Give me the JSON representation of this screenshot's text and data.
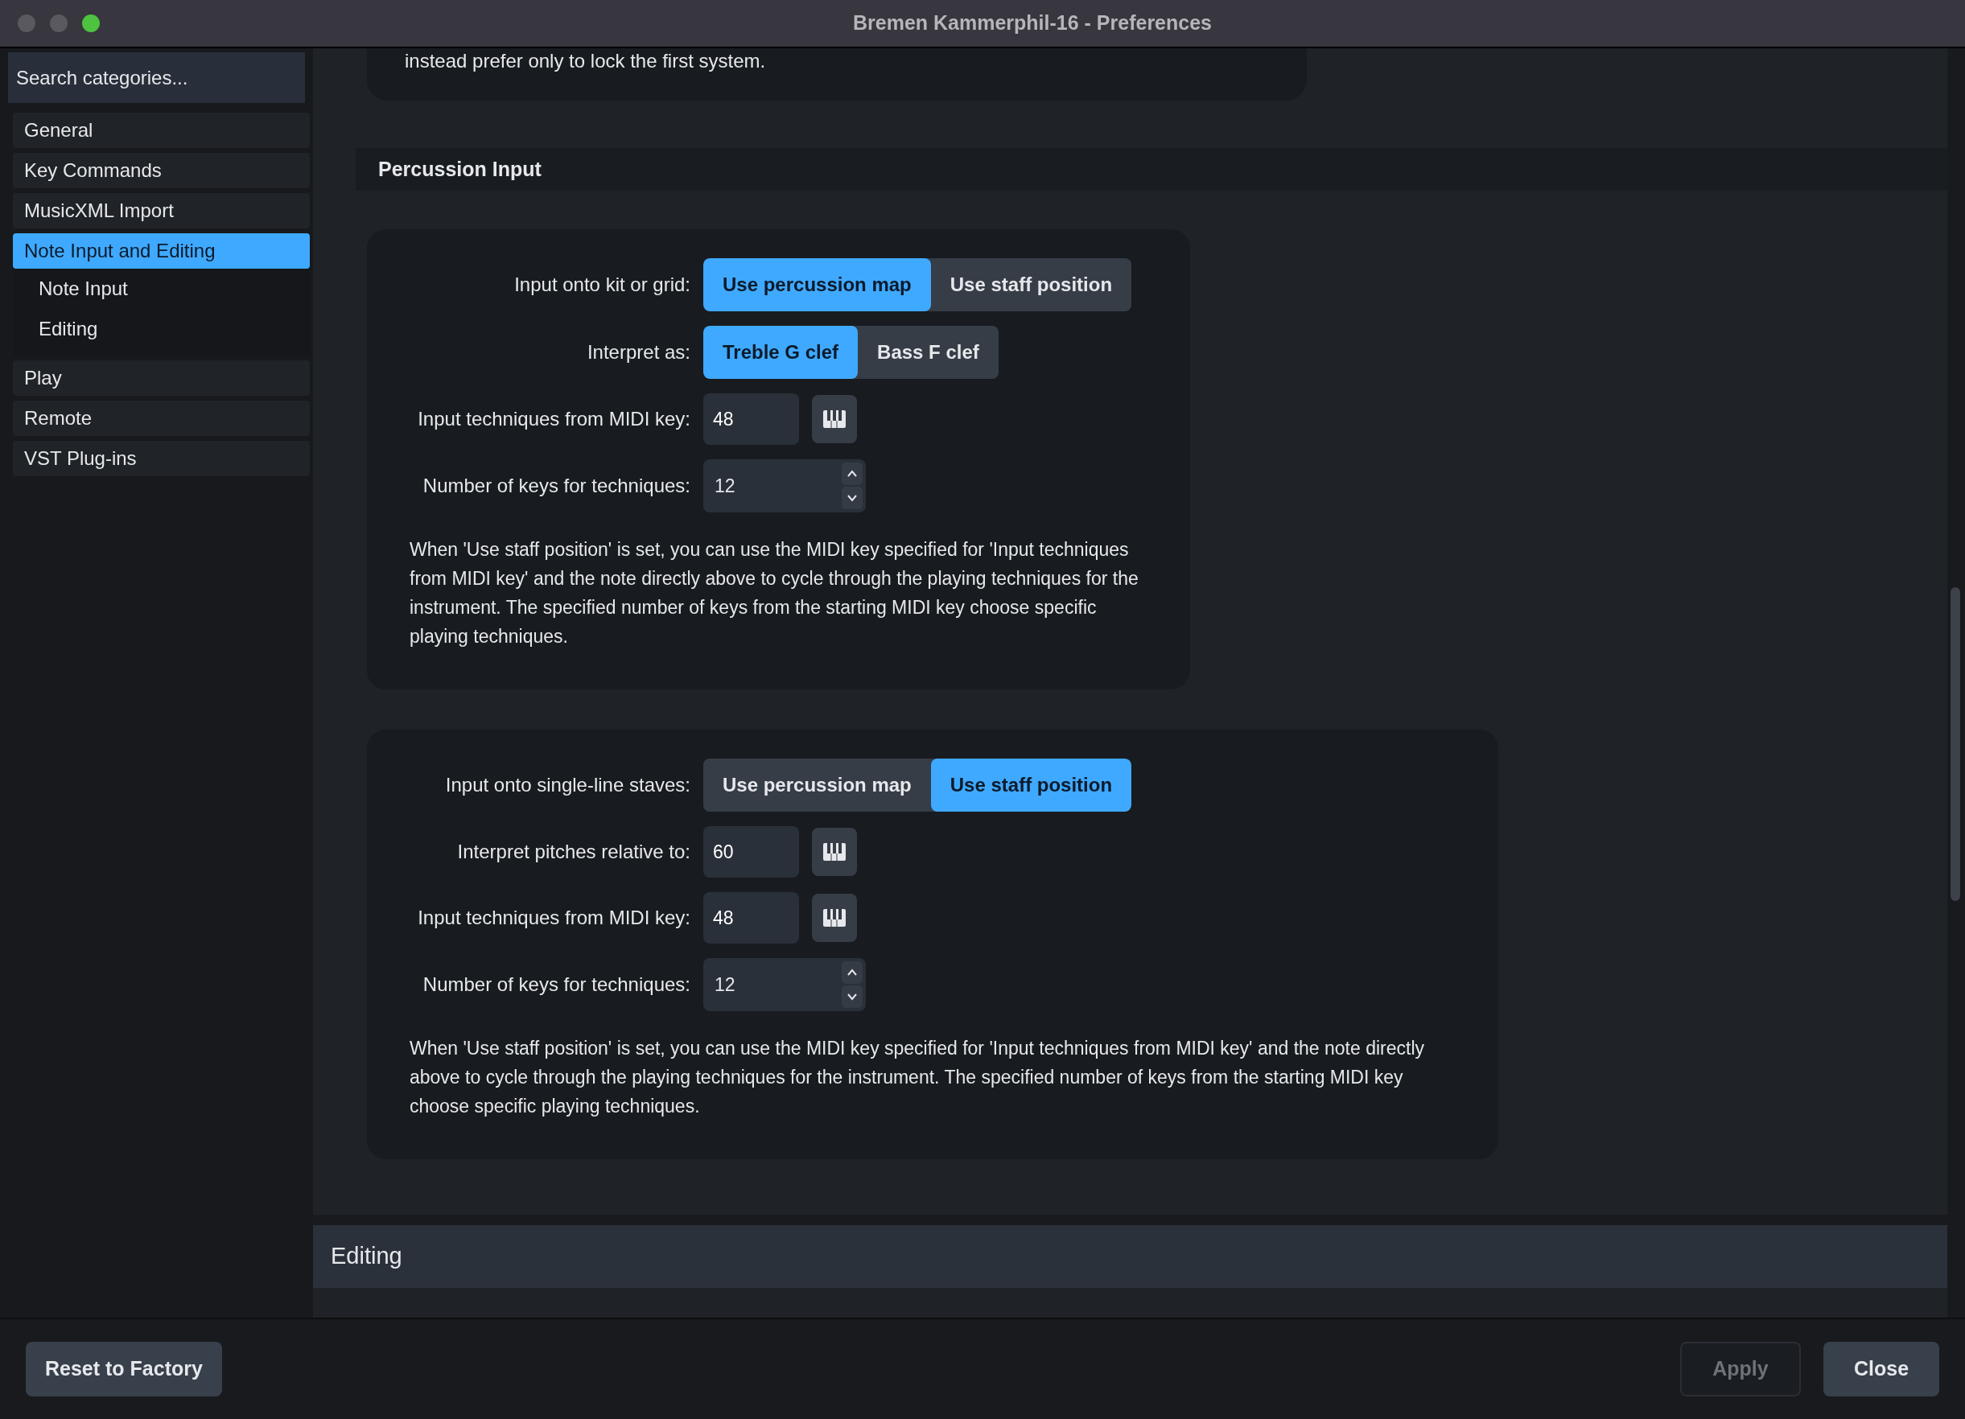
{
  "window": {
    "title": "Bremen Kammerphil-16 - Preferences"
  },
  "sidebar": {
    "search": {
      "placeholder": "Search categories..."
    },
    "items": [
      {
        "label": "General",
        "selected": false
      },
      {
        "label": "Key Commands",
        "selected": false
      },
      {
        "label": "MusicXML Import",
        "selected": false
      },
      {
        "label": "Note Input and Editing",
        "selected": true,
        "children": [
          {
            "label": "Note Input",
            "selected": false
          },
          {
            "label": "Editing",
            "selected": false
          }
        ]
      },
      {
        "label": "Play",
        "selected": false
      },
      {
        "label": "Remote",
        "selected": false
      },
      {
        "label": "VST Plug-ins",
        "selected": false
      }
    ]
  },
  "content": {
    "cut_text": "instead prefer only to lock the first system.",
    "section": {
      "title": "Percussion Input",
      "groups": [
        {
          "rows": [
            {
              "kind": "segmented",
              "label": "Input onto kit or grid:",
              "options": [
                {
                  "label": "Use percussion map",
                  "selected": true
                },
                {
                  "label": "Use staff position",
                  "selected": false
                }
              ]
            },
            {
              "kind": "segmented",
              "label": "Interpret as:",
              "options": [
                {
                  "label": "Treble G clef",
                  "selected": true
                },
                {
                  "label": "Bass F clef",
                  "selected": false
                }
              ]
            },
            {
              "kind": "midi_key",
              "label": "Input techniques from MIDI key:",
              "value": "48"
            },
            {
              "kind": "spinner",
              "label": "Number of keys for techniques:",
              "value": "12"
            }
          ],
          "description": "When 'Use staff position' is set, you can use the MIDI key specified for 'Input techniques from MIDI key' and the note directly above to cycle through the playing techniques for the instrument. The specified number of keys from the starting MIDI key choose specific playing techniques."
        },
        {
          "rows": [
            {
              "kind": "segmented",
              "label": "Input onto single-line staves:",
              "options": [
                {
                  "label": "Use percussion map",
                  "selected": false
                },
                {
                  "label": "Use staff position",
                  "selected": true
                }
              ]
            },
            {
              "kind": "midi_key",
              "label": "Interpret pitches relative to:",
              "value": "60"
            },
            {
              "kind": "midi_key",
              "label": "Input techniques from MIDI key:",
              "value": "48"
            },
            {
              "kind": "spinner",
              "label": "Number of keys for techniques:",
              "value": "12"
            }
          ],
          "description": "When 'Use staff position' is set, you can use the MIDI key specified for 'Input techniques from MIDI key' and the note directly above to cycle through the playing techniques for the instrument. The specified number of keys from the starting MIDI key choose specific playing techniques."
        }
      ]
    },
    "next_section": {
      "title": "Editing"
    }
  },
  "footer": {
    "left_buttons": [
      {
        "label": "Reset to Factory",
        "disabled": false
      }
    ],
    "right_buttons": [
      {
        "label": "Apply",
        "disabled": true
      },
      {
        "label": "Close",
        "disabled": false
      }
    ]
  }
}
